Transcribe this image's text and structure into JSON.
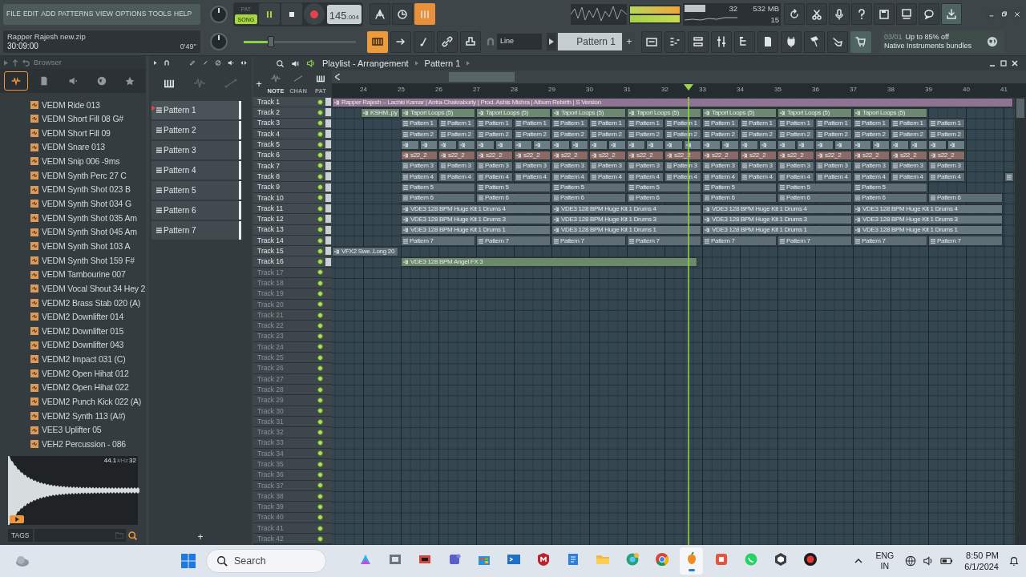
{
  "menu": [
    "FILE",
    "EDIT",
    "ADD",
    "PATTERNS",
    "VIEW",
    "OPTIONS",
    "TOOLS",
    "HELP"
  ],
  "transport": {
    "modes": [
      {
        "label": "PAT",
        "selected": false
      },
      {
        "label": "SONG",
        "selected": true
      }
    ],
    "tempo": "145",
    "tempo_fraction": ".004"
  },
  "monitor": {
    "cpu": "32",
    "memory": "532 MB",
    "polyphony": "15"
  },
  "project": {
    "name": "Rapper Rajesh new.zip",
    "time": "30:09:00",
    "duration": "0'49''"
  },
  "main_slider": {
    "level": 0.24
  },
  "snap": "Line",
  "pattern_selector": "Pattern 1",
  "pattern_add": "+",
  "patterns_add": "+",
  "track_add": "+",
  "news": {
    "date": "03/01",
    "headline": "Up to 85% off",
    "subline": "Native Instruments bundles"
  },
  "browser": {
    "title": "Browser",
    "tabs": [
      {
        "kind": "waveform",
        "selected": true
      },
      {
        "kind": "file",
        "selected": false
      },
      {
        "kind": "speaker",
        "selected": false
      },
      {
        "kind": "globe",
        "selected": false
      },
      {
        "kind": "star",
        "selected": false
      }
    ],
    "items": [
      "VEDM Ride 013",
      "VEDM Short Fill 08 G#",
      "VEDM Short Fill 09",
      "VEDM Snare 013",
      "VEDM Snip 006 -9ms",
      "VEDM Synth Perc 27 C",
      "VEDM Synth Shot 023 B",
      "VEDM Synth Shot 034 G",
      "VEDM Synth Shot 035 Am",
      "VEDM Synth Shot 045 Am",
      "VEDM Synth Shot 103 A",
      "VEDM Synth Shot 159 F#",
      "VEDM Tambourine 007",
      "VEDM Vocal Shout 34 Hey 2",
      "VEDM2 Brass Stab 020 (A)",
      "VEDM2 Downlifter 014",
      "VEDM2 Downlifter 015",
      "VEDM2 Downlifter 043",
      "VEDM2 Impact 031 (C)",
      "VEDM2 Open Hihat 012",
      "VEDM2 Open Hihat 022",
      "VEDM2 Punch Kick 022 (A)",
      "VEDM2 Synth 113 (A#)",
      "VEE3 Uplifter 05",
      "VEH2 Percussion - 086"
    ],
    "sample_rate": "44.1",
    "sample_unit": "kHz",
    "bit_depth": "32",
    "tags_label": "TAGS"
  },
  "patterns": [
    {
      "label": "Pattern 1",
      "selected": true
    },
    {
      "label": "Pattern 2",
      "selected": false
    },
    {
      "label": "Pattern 3",
      "selected": false
    },
    {
      "label": "Pattern 4",
      "selected": false
    },
    {
      "label": "Pattern 5",
      "selected": false
    },
    {
      "label": "Pattern 6",
      "selected": false
    },
    {
      "label": "Pattern 7",
      "selected": false
    }
  ],
  "playlist": {
    "title": "Playlist - Arrangement",
    "pattern": "Pattern 1",
    "tool_labels": [
      "NOTE",
      "CHAN",
      "PAT"
    ],
    "ruler": [
      "24",
      "25",
      "26",
      "27",
      "28",
      "29",
      "30",
      "31",
      "32",
      "33",
      "34",
      "35",
      "36",
      "37",
      "38",
      "39",
      "40",
      "41"
    ],
    "tracks": [
      {
        "name": "Track 1",
        "color": "#8f7491",
        "clips": [
          {
            "kind": "audio",
            "label": "Rapper Rajesh – Lachki Kamar  |  Antra Chakraborty  |  Prod. Ashis Mishra  |  Album Rebirth  |  S Version"
          }
        ]
      },
      {
        "name": "Track 2",
        "color": "#6d8870",
        "clips": [
          {
            "kind": "audio",
            "label": "KSHM..py"
          },
          {
            "kind": "audio",
            "label": "Tapori Loops (5)"
          },
          {
            "kind": "audio",
            "label": "Tapori Loops (5)"
          },
          {
            "kind": "audio",
            "label": "Tapori Loops (5)"
          },
          {
            "kind": "audio",
            "label": "Tapori Loops (5)"
          },
          {
            "kind": "audio",
            "label": "Tapori Loops (5)"
          },
          {
            "kind": "audio",
            "label": "Tapori Loops (5)"
          },
          {
            "kind": "audio",
            "label": "Tapori Loops (5)"
          }
        ]
      },
      {
        "name": "Track 3",
        "color": "#5e6e77",
        "clips": [
          {
            "kind": "pattern",
            "label": "Pattern 1"
          },
          {
            "kind": "pattern",
            "label": "Pattern 1"
          },
          {
            "kind": "pattern",
            "label": "Pattern 1"
          },
          {
            "kind": "pattern",
            "label": "Pattern 1"
          },
          {
            "kind": "pattern",
            "label": "Pattern 1"
          },
          {
            "kind": "pattern",
            "label": "Pattern 1"
          },
          {
            "kind": "pattern",
            "label": "Pattern 1"
          },
          {
            "kind": "pattern",
            "label": "Pattern 1"
          },
          {
            "kind": "pattern",
            "label": "Pattern 1"
          },
          {
            "kind": "pattern",
            "label": "Pattern 1"
          },
          {
            "kind": "pattern",
            "label": "Pattern 1"
          },
          {
            "kind": "pattern",
            "label": "Pattern 1"
          },
          {
            "kind": "pattern",
            "label": "Pattern 1"
          },
          {
            "kind": "pattern",
            "label": "Pattern 1"
          },
          {
            "kind": "pattern",
            "label": "Pattern 1"
          }
        ]
      },
      {
        "name": "Track 4",
        "color": "#5e6e77",
        "clips": [
          {
            "kind": "pattern",
            "label": "Pattern 2"
          },
          {
            "kind": "pattern",
            "label": "Pattern 2"
          },
          {
            "kind": "pattern",
            "label": "Pattern 2"
          },
          {
            "kind": "pattern",
            "label": "Pattern 2"
          },
          {
            "kind": "pattern",
            "label": "Pattern 2"
          },
          {
            "kind": "pattern",
            "label": "Pattern 2"
          },
          {
            "kind": "pattern",
            "label": "Pattern 2"
          },
          {
            "kind": "pattern",
            "label": "Pattern 2"
          },
          {
            "kind": "pattern",
            "label": "Pattern 2"
          },
          {
            "kind": "pattern",
            "label": "Pattern 2"
          },
          {
            "kind": "pattern",
            "label": "Pattern 2"
          },
          {
            "kind": "pattern",
            "label": "Pattern 2"
          },
          {
            "kind": "pattern",
            "label": "Pattern 2"
          },
          {
            "kind": "pattern",
            "label": "Pattern 2"
          },
          {
            "kind": "pattern",
            "label": "Pattern 2"
          }
        ]
      },
      {
        "name": "Track 5",
        "color": "#687d84",
        "clips": [
          {
            "kind": "audio"
          },
          {
            "kind": "audio"
          },
          {
            "kind": "audio"
          },
          {
            "kind": "audio"
          },
          {
            "kind": "audio"
          },
          {
            "kind": "audio"
          },
          {
            "kind": "audio"
          },
          {
            "kind": "audio"
          },
          {
            "kind": "audio"
          },
          {
            "kind": "audio"
          },
          {
            "kind": "audio"
          },
          {
            "kind": "audio"
          },
          {
            "kind": "audio"
          },
          {
            "kind": "audio"
          },
          {
            "kind": "audio"
          },
          {
            "kind": "audio"
          },
          {
            "kind": "audio"
          },
          {
            "kind": "audio"
          },
          {
            "kind": "audio"
          },
          {
            "kind": "audio"
          },
          {
            "kind": "audio"
          },
          {
            "kind": "audio"
          },
          {
            "kind": "audio"
          },
          {
            "kind": "audio"
          },
          {
            "kind": "audio"
          },
          {
            "kind": "audio"
          },
          {
            "kind": "audio"
          },
          {
            "kind": "audio"
          },
          {
            "kind": "audio"
          },
          {
            "kind": "audio"
          }
        ]
      },
      {
        "name": "Track 6",
        "color": "#8a6a65",
        "clips": [
          {
            "kind": "audio",
            "label": "s22_2"
          },
          {
            "kind": "audio",
            "label": "s22_2"
          },
          {
            "kind": "audio",
            "label": "s22_2"
          },
          {
            "kind": "audio",
            "label": "s22_2"
          },
          {
            "kind": "audio",
            "label": "s22_2"
          },
          {
            "kind": "audio",
            "label": "s22_2"
          },
          {
            "kind": "audio",
            "label": "s22_2"
          },
          {
            "kind": "audio",
            "label": "s22_2"
          },
          {
            "kind": "audio",
            "label": "s22_2"
          },
          {
            "kind": "audio",
            "label": "s22_2"
          },
          {
            "kind": "audio",
            "label": "s22_2"
          },
          {
            "kind": "audio",
            "label": "s22_2"
          },
          {
            "kind": "audio",
            "label": "s22_2"
          },
          {
            "kind": "audio",
            "label": "s22_2"
          },
          {
            "kind": "audio",
            "label": "s22_2"
          }
        ]
      },
      {
        "name": "Track 7",
        "color": "#5e6e77",
        "clips": [
          {
            "kind": "pattern",
            "label": "Pattern 3"
          },
          {
            "kind": "pattern",
            "label": "Pattern 3"
          },
          {
            "kind": "pattern",
            "label": "Pattern 3"
          },
          {
            "kind": "pattern",
            "label": "Pattern 3"
          },
          {
            "kind": "pattern",
            "label": "Pattern 3"
          },
          {
            "kind": "pattern",
            "label": "Pattern 3"
          },
          {
            "kind": "pattern",
            "label": "Pattern 3"
          },
          {
            "kind": "pattern",
            "label": "Pattern 3"
          },
          {
            "kind": "pattern",
            "label": "Pattern 3"
          },
          {
            "kind": "pattern",
            "label": "Pattern 3"
          },
          {
            "kind": "pattern",
            "label": "Pattern 3"
          },
          {
            "kind": "pattern",
            "label": "Pattern 3"
          },
          {
            "kind": "pattern",
            "label": "Pattern 3"
          },
          {
            "kind": "pattern",
            "label": "Pattern 3"
          },
          {
            "kind": "pattern",
            "label": "Pattern 3"
          }
        ]
      },
      {
        "name": "Track 8",
        "color": "#5e6e77",
        "clips": [
          {
            "kind": "pattern",
            "label": "Pattern 4"
          },
          {
            "kind": "pattern",
            "label": "Pattern 4"
          },
          {
            "kind": "pattern",
            "label": "Pattern 4"
          },
          {
            "kind": "pattern",
            "label": "Pattern 4"
          },
          {
            "kind": "pattern",
            "label": "Pattern 4"
          },
          {
            "kind": "pattern",
            "label": "Pattern 4"
          },
          {
            "kind": "pattern",
            "label": "Pattern 4"
          },
          {
            "kind": "pattern",
            "label": "Pattern 4"
          },
          {
            "kind": "pattern",
            "label": "Pattern 4"
          },
          {
            "kind": "pattern",
            "label": "Pattern 4"
          },
          {
            "kind": "pattern",
            "label": "Pattern 4"
          },
          {
            "kind": "pattern",
            "label": "Pattern 4"
          },
          {
            "kind": "pattern",
            "label": "Pattern 4"
          },
          {
            "kind": "pattern",
            "label": "Pattern 4"
          },
          {
            "kind": "pattern",
            "label": "Pattern 4"
          },
          {
            "kind": "pattern"
          }
        ]
      },
      {
        "name": "Track 9",
        "color": "#5e6e77",
        "clips": [
          {
            "kind": "pattern",
            "label": "Pattern 5"
          },
          {
            "kind": "pattern",
            "label": "Pattern 5"
          },
          {
            "kind": "pattern",
            "label": "Pattern 5"
          },
          {
            "kind": "pattern",
            "label": "Pattern 5"
          },
          {
            "kind": "pattern",
            "label": "Pattern 5"
          },
          {
            "kind": "pattern",
            "label": "Pattern 5"
          },
          {
            "kind": "pattern",
            "label": "Pattern 5"
          }
        ]
      },
      {
        "name": "Track 10",
        "color": "#5e6e77",
        "clips": [
          {
            "kind": "pattern",
            "label": "Pattern 6"
          },
          {
            "kind": "pattern",
            "label": "Pattern 6"
          },
          {
            "kind": "pattern",
            "label": "Pattern 6"
          },
          {
            "kind": "pattern",
            "label": "Pattern 6"
          },
          {
            "kind": "pattern",
            "label": "Pattern 6"
          },
          {
            "kind": "pattern",
            "label": "Pattern 6"
          },
          {
            "kind": "pattern",
            "label": "Pattern 6"
          },
          {
            "kind": "pattern",
            "label": "Pattern 6"
          }
        ]
      },
      {
        "name": "Track 11",
        "color": "#66777f",
        "clips": [
          {
            "kind": "audio",
            "label": "VDE3 128 BPM Huge Kit 1 Drums 4"
          },
          {
            "kind": "audio",
            "label": "VDE3 128 BPM Huge Kit 1 Drums 4"
          },
          {
            "kind": "audio",
            "label": "VDE3 128 BPM Huge Kit 1 Drums 4"
          },
          {
            "kind": "audio",
            "label": "VDE3 128 BPM Huge Kit 1 Drums 4"
          }
        ]
      },
      {
        "name": "Track 12",
        "color": "#66777f",
        "clips": [
          {
            "kind": "audio",
            "label": "VDE3 128 BPM Huge Kit 1 Drums 3"
          },
          {
            "kind": "audio",
            "label": "VDE3 128 BPM Huge Kit 1 Drums 3"
          },
          {
            "kind": "audio",
            "label": "VDE3 128 BPM Huge Kit 1 Drums 3"
          },
          {
            "kind": "audio",
            "label": "VDE3 128 BPM Huge Kit 1 Drums 3"
          }
        ]
      },
      {
        "name": "Track 13",
        "color": "#66777f",
        "clips": [
          {
            "kind": "audio",
            "label": "VDE3 128 BPM Huge Kit 1 Drums 1"
          },
          {
            "kind": "audio",
            "label": "VDE3 128 BPM Huge Kit 1 Drums 1"
          },
          {
            "kind": "audio",
            "label": "VDE3 128 BPM Huge Kit 1 Drums 1"
          },
          {
            "kind": "audio",
            "label": "VDE3 128 BPM Huge Kit 1 Drums 1"
          }
        ]
      },
      {
        "name": "Track 14",
        "color": "#5e6e77",
        "clips": [
          {
            "kind": "pattern",
            "label": "Pattern 7"
          },
          {
            "kind": "pattern",
            "label": "Pattern 7"
          },
          {
            "kind": "pattern",
            "label": "Pattern 7"
          },
          {
            "kind": "pattern",
            "label": "Pattern 7"
          },
          {
            "kind": "pattern",
            "label": "Pattern 7"
          },
          {
            "kind": "pattern",
            "label": "Pattern 7"
          },
          {
            "kind": "pattern",
            "label": "Pattern 7"
          },
          {
            "kind": "pattern",
            "label": "Pattern 7"
          }
        ]
      },
      {
        "name": "Track 15",
        "color": "#5e6e77",
        "clips": [
          {
            "kind": "audio",
            "label": "VFX2 Swe..Long 20"
          }
        ]
      },
      {
        "name": "Track 16",
        "color": "#6b896b",
        "clips": [
          {
            "kind": "audio",
            "label": "VDE3 128 BPM Angel FX 3"
          }
        ]
      },
      {
        "name": "Track 17"
      },
      {
        "name": "Track 18"
      },
      {
        "name": "Track 19"
      },
      {
        "name": "Track 20"
      },
      {
        "name": "Track 21"
      },
      {
        "name": "Track 22"
      },
      {
        "name": "Track 23"
      },
      {
        "name": "Track 24"
      },
      {
        "name": "Track 25"
      },
      {
        "name": "Track 26"
      },
      {
        "name": "Track 27"
      },
      {
        "name": "Track 28"
      },
      {
        "name": "Track 29"
      },
      {
        "name": "Track 30"
      },
      {
        "name": "Track 31"
      },
      {
        "name": "Track 32"
      },
      {
        "name": "Track 33"
      },
      {
        "name": "Track 34"
      },
      {
        "name": "Track 35"
      },
      {
        "name": "Track 36"
      },
      {
        "name": "Track 37"
      },
      {
        "name": "Track 38"
      },
      {
        "name": "Track 39"
      },
      {
        "name": "Track 40"
      },
      {
        "name": "Track 41"
      },
      {
        "name": "Track 42"
      }
    ]
  },
  "taskbar": {
    "search": "Search",
    "language": "ENG",
    "region": "IN",
    "time": "8:50 PM",
    "date": "6/1/2024",
    "apps": [
      {
        "kind": "copilot",
        "selected": false
      },
      {
        "kind": "files",
        "selected": false
      },
      {
        "kind": "slides",
        "selected": false
      },
      {
        "kind": "teams",
        "selected": false
      },
      {
        "kind": "store",
        "selected": false
      },
      {
        "kind": "terminal",
        "selected": false
      },
      {
        "kind": "shield",
        "selected": false
      },
      {
        "kind": "notes",
        "selected": false
      },
      {
        "kind": "folder",
        "selected": false
      },
      {
        "kind": "browser",
        "selected": false
      },
      {
        "kind": "chrome",
        "selected": false
      },
      {
        "kind": "fruit",
        "selected": true
      },
      {
        "kind": "office",
        "selected": false
      },
      {
        "kind": "chat",
        "selected": false
      },
      {
        "kind": "cube",
        "selected": false
      },
      {
        "kind": "record",
        "selected": false
      }
    ]
  }
}
